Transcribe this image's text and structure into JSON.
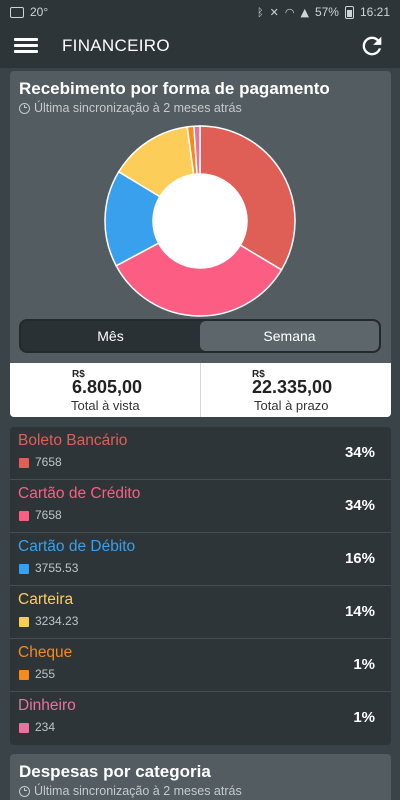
{
  "status": {
    "temperature": "20°",
    "battery": "57%",
    "time": "16:21"
  },
  "appbar": {
    "title": "FINANCEIRO"
  },
  "payments_card": {
    "title": "Recebimento por forma de pagamento",
    "sync": "Última sincronização à 2 meses atrás",
    "tabs": [
      {
        "label": "Mês",
        "active": false
      },
      {
        "label": "Semana",
        "active": true
      }
    ],
    "totals": [
      {
        "currency": "R$",
        "value": "6.805,00",
        "label": "Total à vista"
      },
      {
        "currency": "R$",
        "value": "22.335,00",
        "label": "Total à prazo"
      }
    ]
  },
  "chart_data": {
    "type": "pie",
    "donut": true,
    "categories": [
      "Boleto Bancário",
      "Cartão de Crédito",
      "Cartão de Débito",
      "Carteira",
      "Cheque",
      "Dinheiro"
    ],
    "values": [
      7658,
      7658,
      3755.53,
      3234.23,
      255,
      234
    ],
    "colors": [
      "#df5f57",
      "#fb5e82",
      "#38a0ec",
      "#fdcd5a",
      "#f68a1c",
      "#e9739d"
    ]
  },
  "methods": [
    {
      "name": "Boleto Bancário",
      "amount": "7658",
      "percent": "34%",
      "color": "#df5f57"
    },
    {
      "name": "Cartão de Crédito",
      "amount": "7658",
      "percent": "34%",
      "color": "#fb5e82"
    },
    {
      "name": "Cartão de Débito",
      "amount": "3755.53",
      "percent": "16%",
      "color": "#38a0ec"
    },
    {
      "name": "Carteira",
      "amount": "3234.23",
      "percent": "14%",
      "color": "#fdcd5a"
    },
    {
      "name": "Cheque",
      "amount": "255",
      "percent": "1%",
      "color": "#f68a1c"
    },
    {
      "name": "Dinheiro",
      "amount": "234",
      "percent": "1%",
      "color": "#e9739d"
    }
  ],
  "expenses_card": {
    "title": "Despesas por categoria",
    "sync": "Última sincronização à 2 meses atrás"
  }
}
